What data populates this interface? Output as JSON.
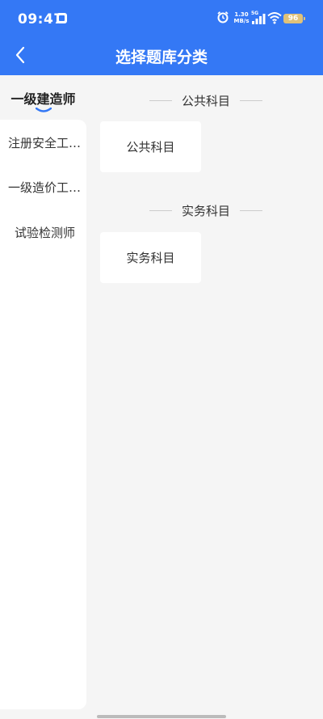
{
  "status_bar": {
    "time": "09:47",
    "speed_value": "1.30",
    "speed_unit": "MB/s",
    "network": "5G",
    "battery": "96"
  },
  "header": {
    "title": "选择题库分类",
    "accent_color": "#3478f5"
  },
  "sidebar": {
    "selected": "一级建造师",
    "items": [
      {
        "label": "注册安全工…"
      },
      {
        "label": "一级造价工…"
      },
      {
        "label": "试验检测师"
      }
    ]
  },
  "sections": [
    {
      "title": "公共科目",
      "cards": [
        {
          "label": "公共科目"
        }
      ]
    },
    {
      "title": "实务科目",
      "cards": [
        {
          "label": "实务科目"
        }
      ]
    }
  ]
}
